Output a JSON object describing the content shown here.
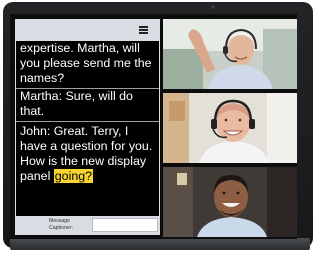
{
  "app": {
    "menu_icon": "hamburger-menu-icon"
  },
  "captions": [
    {
      "speaker": "",
      "text": "expertise.  Martha, will you please send me the names?"
    },
    {
      "speaker": "Martha:",
      "text": " Sure, will do that."
    },
    {
      "speaker": "John:",
      "text": " Great.  Terry, I have a question for you. How is the new display panel",
      "highlight": "going?"
    }
  ],
  "message_bar": {
    "label": "Message Captioner:",
    "input_value": ""
  },
  "participants": [
    {
      "name": "",
      "description": "older man with headset, hand raised"
    },
    {
      "name": "",
      "description": "smiling older bald man with headset"
    },
    {
      "name": "",
      "description": "smiling young man"
    }
  ],
  "colors": {
    "caption_bg": "#000000",
    "caption_text": "#ffffff",
    "highlight": "#f7d430",
    "panel_chrome": "#d9dde3"
  }
}
